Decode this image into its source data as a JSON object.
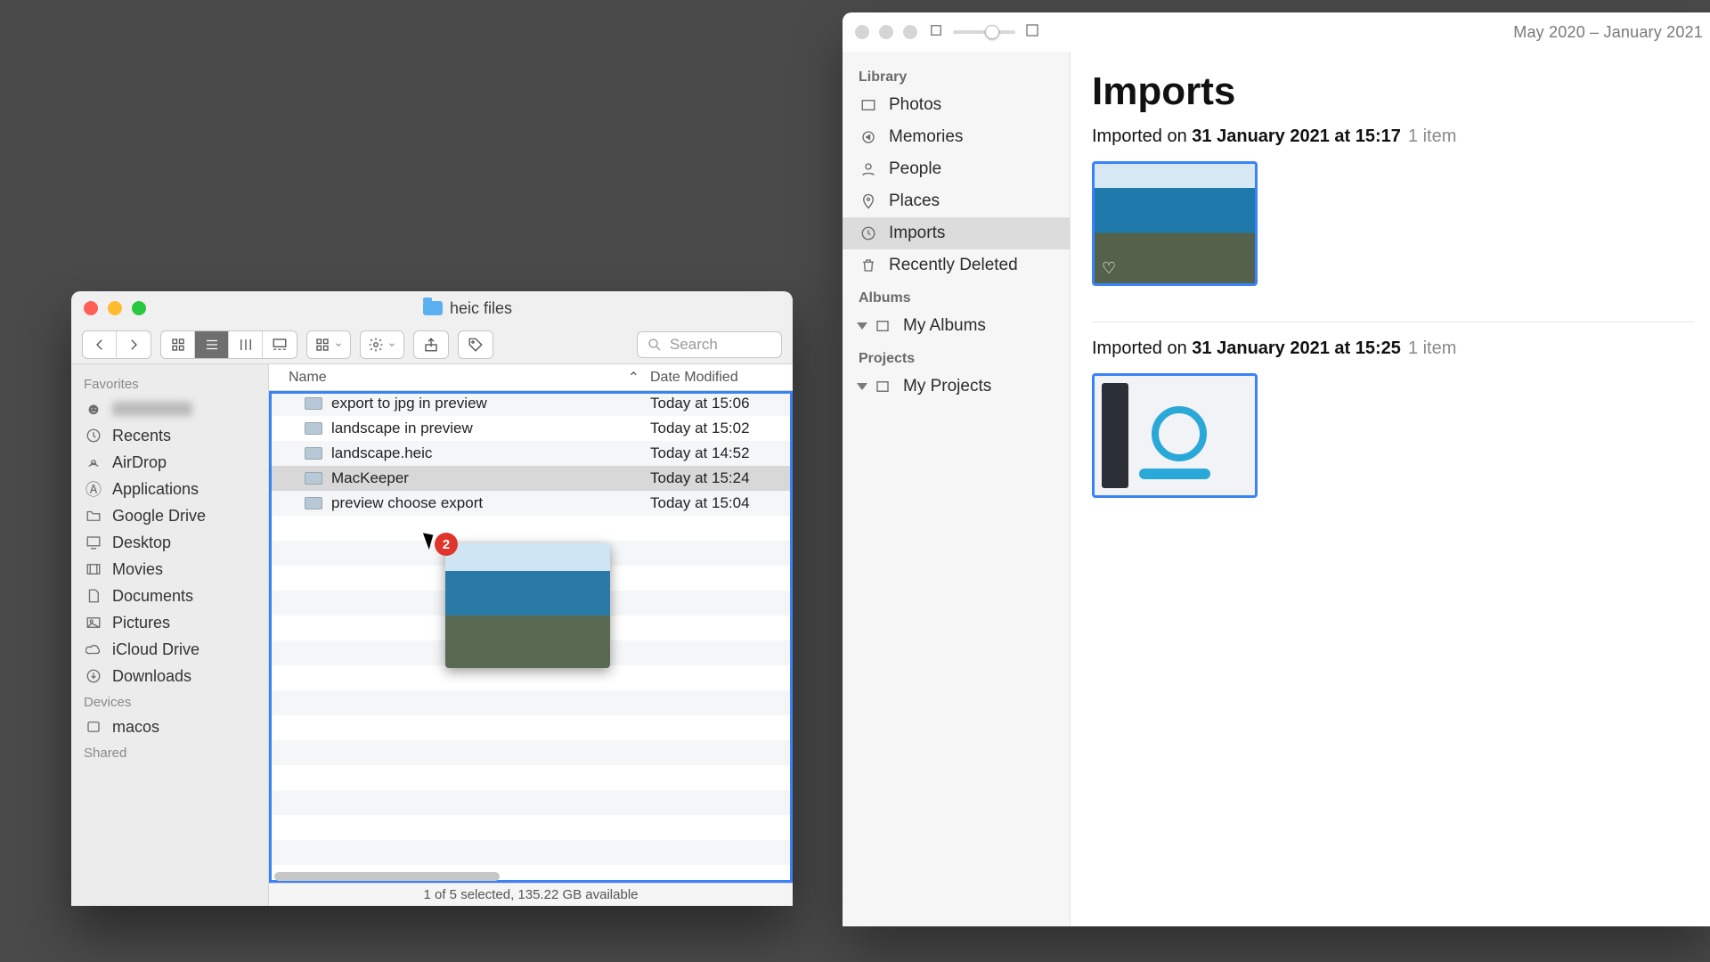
{
  "finder": {
    "title": "heic files",
    "toolbar": {
      "search_placeholder": "Search"
    },
    "sidebar": {
      "favorites_header": "Favorites",
      "items": [
        {
          "label": "",
          "icon": "user-icon"
        },
        {
          "label": "Recents",
          "icon": "clock-icon"
        },
        {
          "label": "AirDrop",
          "icon": "airdrop-icon"
        },
        {
          "label": "Applications",
          "icon": "apps-icon"
        },
        {
          "label": "Google Drive",
          "icon": "folder-icon"
        },
        {
          "label": "Desktop",
          "icon": "desktop-icon"
        },
        {
          "label": "Movies",
          "icon": "movies-icon"
        },
        {
          "label": "Documents",
          "icon": "documents-icon"
        },
        {
          "label": "Pictures",
          "icon": "pictures-icon"
        },
        {
          "label": "iCloud Drive",
          "icon": "cloud-icon"
        },
        {
          "label": "Downloads",
          "icon": "download-icon"
        }
      ],
      "devices_header": "Devices",
      "devices": [
        {
          "label": "macos",
          "icon": "disk-icon"
        }
      ],
      "shared_header": "Shared"
    },
    "columns": {
      "name": "Name",
      "date": "Date Modified"
    },
    "files": [
      {
        "name": "export to jpg in preview",
        "date": "Today at 15:06",
        "selected": false
      },
      {
        "name": "landscape in preview",
        "date": "Today at 15:02",
        "selected": false
      },
      {
        "name": "landscape.heic",
        "date": "Today at 14:52",
        "selected": false
      },
      {
        "name": "MacKeeper",
        "date": "Today at 15:24",
        "selected": true
      },
      {
        "name": "preview choose export",
        "date": "Today at 15:04",
        "selected": false
      }
    ],
    "drag_badge": "2",
    "status": "1 of 5 selected, 135.22 GB available"
  },
  "photos": {
    "date_range": "May 2020 – January 2021",
    "sidebar": {
      "library_header": "Library",
      "library": [
        {
          "label": "Photos",
          "icon": "photos-icon"
        },
        {
          "label": "Memories",
          "icon": "memories-icon"
        },
        {
          "label": "People",
          "icon": "people-icon"
        },
        {
          "label": "Places",
          "icon": "places-icon"
        },
        {
          "label": "Imports",
          "icon": "imports-icon",
          "selected": true
        },
        {
          "label": "Recently Deleted",
          "icon": "trash-icon"
        }
      ],
      "albums_header": "Albums",
      "albums": [
        {
          "label": "My Albums",
          "icon": "album-icon",
          "disclosure": true
        }
      ],
      "projects_header": "Projects",
      "projects": [
        {
          "label": "My Projects",
          "icon": "project-icon",
          "disclosure": true
        }
      ]
    },
    "main": {
      "title": "Imports",
      "sections": [
        {
          "heading_prefix": "Imported on ",
          "heading_bold": "31 January 2021 at 15:17",
          "count": "1 item",
          "thumb": "lake",
          "heart": true
        },
        {
          "heading_prefix": "Imported on ",
          "heading_bold": "31 January 2021 at 15:25",
          "count": "1 item",
          "thumb": "app",
          "heart": false
        }
      ]
    }
  }
}
